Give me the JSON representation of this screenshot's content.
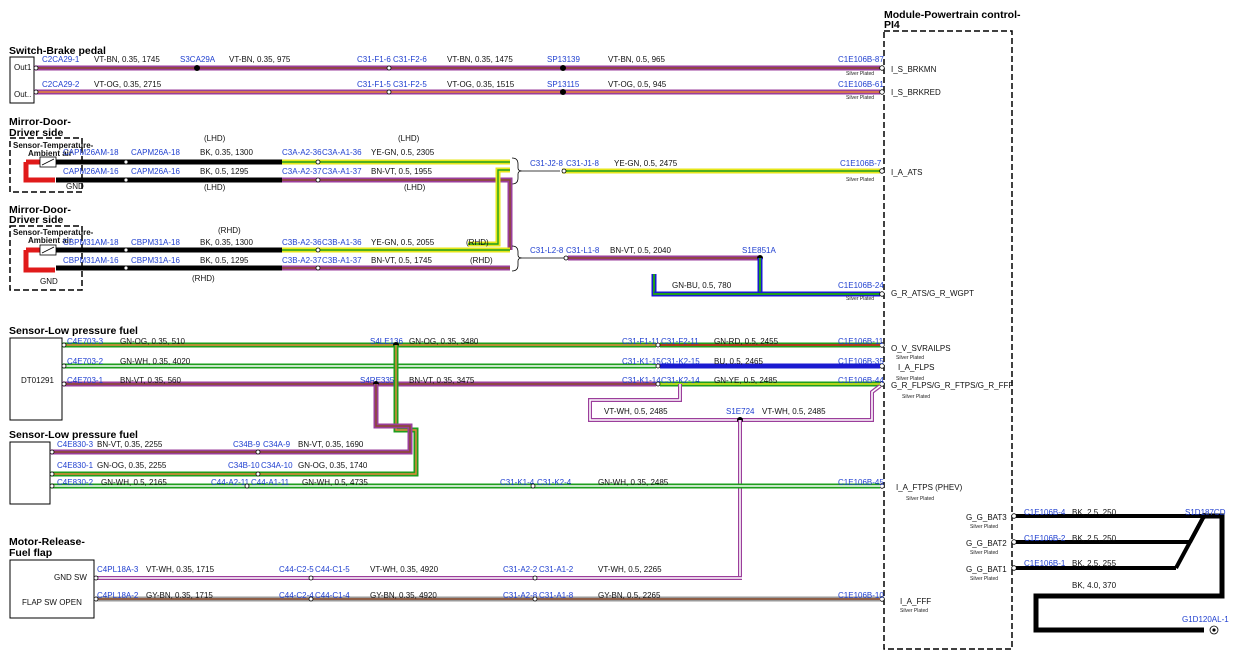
{
  "module": {
    "title_line1": "Module-Powertrain control-",
    "title_line2": "PI4",
    "pins": {
      "brkmn": "I_S_BRKMN",
      "brkred": "I_S_BRKRED",
      "ats": "I_A_ATS",
      "ats_wgpt": "G_R_ATS/G_R_WGPT",
      "svrailps": "O_V_SVRAILPS",
      "flps": "I_A_FLPS",
      "flps_ftps": "G_R_FLPS/G_R_FTPS/G_R_FFF",
      "ftps": "I_A_FTPS (PHEV)",
      "fff": "I_A_FFF",
      "bat3": "G_G_BAT3",
      "bat2": "G_G_BAT2",
      "bat1": "G_G_BAT1"
    },
    "silver": "Silver Plated"
  },
  "brake": {
    "title": "Switch-Brake pedal",
    "out1": "Out1",
    "out2": "Out..",
    "w1": {
      "c1": "C2CA29-1",
      "t1": "VT-BN, 0.35, 1745",
      "sp": "S3CA29A",
      "t2": "VT-BN, 0.35, 975",
      "c2": "C31-F1-6",
      "c3": "C31-F2-6",
      "t3": "VT-BN, 0.35, 1475",
      "sp2": "SP13139",
      "t4": "VT-BN, 0.5, 965",
      "c4": "C1E106B-87"
    },
    "w2": {
      "c1": "C2CA29-2",
      "t1": "VT-OG, 0.35, 2715",
      "c2": "C31-F1-5",
      "c3": "C31-F2-5",
      "t3": "VT-OG, 0.35, 1515",
      "sp2": "SP13115",
      "t4": "VT-OG, 0.5, 945",
      "c4": "C1E106B-61"
    }
  },
  "mirror1": {
    "title1": "Mirror-Door-",
    "title2": "Driver side",
    "sensor1": "Sensor-Temperature-",
    "sensor2": "Ambient air",
    "gnd": "GND",
    "lhd": "(LHD)",
    "w1": {
      "c1": "CAPM26AM-18",
      "c2": "CAPM26A-18",
      "t1": "BK, 0.35, 1300",
      "c3": "C3A-A2-36",
      "c4": "C3A-A1-36",
      "t2": "YE-GN, 0.5, 2305"
    },
    "w2": {
      "c1": "CAPM26AM-16",
      "c2": "CAPM26A-16",
      "t1": "BK, 0.5, 1295",
      "c3": "C3A-A2-37",
      "c4": "C3A-A1-37",
      "t2": "BN-VT, 0.5, 1955"
    },
    "out": {
      "c1": "C31-J2-8",
      "c2": "C31-J1-8",
      "t": "YE-GN, 0.5, 2475",
      "c3": "C1E106B-7"
    }
  },
  "mirror2": {
    "title1": "Mirror-Door-",
    "title2": "Driver side",
    "sensor1": "Sensor-Temperature-",
    "sensor2": "Ambient air",
    "gnd": "GND",
    "rhd": "(RHD)",
    "w1": {
      "c1": "CBPM31AM-18",
      "c2": "CBPM31A-18",
      "t1": "BK, 0.35, 1300",
      "c3": "C3B-A2-36",
      "c4": "C3B-A1-36",
      "t2": "YE-GN, 0.5, 2055"
    },
    "w2": {
      "c1": "CBPM31AM-16",
      "c2": "CBPM31A-16",
      "t1": "BK, 0.5, 1295",
      "c3": "C3B-A2-37",
      "c4": "C3B-A1-37",
      "t2": "BN-VT, 0.5, 1745"
    },
    "out": {
      "c1": "C31-L2-8",
      "c2": "C31-L1-8",
      "t": "BN-VT, 0.5, 2040",
      "sp": "S1E851A"
    },
    "gnbu": {
      "t": "GN-BU, 0.5, 780",
      "c": "C1E106B-24"
    }
  },
  "fuel1": {
    "title": "Sensor-Low pressure fuel",
    "box": "DT01291",
    "w1": {
      "c1": "C4E703-3",
      "t1": "GN-OG, 0.35, 510",
      "sp": "S4LE136",
      "t2": "GN-OG, 0.35, 3480",
      "c2": "C31-F1-11",
      "c3": "C31-F2-11",
      "t3": "GN-RD, 0.5, 2455",
      "c4": "C1E106B-11"
    },
    "w2": {
      "c1": "C4E703-2",
      "t1": "GN-WH, 0.35, 4020",
      "c2": "C31-K1-15",
      "c3": "C31-K2-15",
      "t3": "BU, 0.5, 2465",
      "c4": "C1E106B-35"
    },
    "w3": {
      "c1": "C4E703-1",
      "t1": "BN-VT, 0.35, 560",
      "sp": "S4RE335",
      "t2": "BN-VT, 0.35, 3475",
      "c2": "C31-K1-14",
      "c3": "C31-K2-14",
      "t3": "GN-YE, 0.5, 2485",
      "c4": "C1E106B-44"
    },
    "vtwh": {
      "t1": "VT-WH, 0.5, 2485",
      "sp": "S1E724",
      "t2": "VT-WH, 0.5, 2485"
    }
  },
  "fuel2": {
    "title": "Sensor-Low pressure fuel",
    "w1": {
      "c1": "C4E830-3",
      "t1": "BN-VT, 0.35, 2255",
      "c2": "C34B-9",
      "c3": "C34A-9",
      "t2": "BN-VT, 0.35, 1690"
    },
    "w2": {
      "c1": "C4E830-1",
      "t1": "GN-OG, 0.35, 2255",
      "c2": "C34B-10",
      "c3": "C34A-10",
      "t2": "GN-OG, 0.35, 1740"
    },
    "w3": {
      "c1": "C4E830-2",
      "t1": "GN-WH, 0.5, 2165",
      "c2": "C44-A2-11",
      "c3": "C44-A1-11",
      "t2": "GN-WH, 0.5, 4735",
      "c4": "C31-K1-4",
      "c5": "C31-K2-4",
      "t3": "GN-WH, 0.35, 2485",
      "c6": "C1E106B-45"
    }
  },
  "motor": {
    "title1": "Motor-Release-",
    "title2": "Fuel flap",
    "gndsw": "GND SW",
    "flapsw": "FLAP SW OPEN",
    "w1": {
      "c1": "C4PL18A-3",
      "t1": "VT-WH, 0.35, 1715",
      "c2": "C44-C2-5",
      "c3": "C44-C1-5",
      "t2": "VT-WH, 0.35, 4920",
      "c4": "C31-A2-2",
      "c5": "C31-A1-2",
      "t3": "VT-WH, 0.5, 2265"
    },
    "w2": {
      "c1": "C4PL18A-2",
      "t1": "GY-BN, 0.35, 1715",
      "c2": "C44-C2-4",
      "c3": "C44-C1-4",
      "t2": "GY-BN, 0.35, 4920",
      "c4": "C31-A2-8",
      "c5": "C31-A1-8",
      "t3": "GY-BN, 0.5, 2265",
      "c6": "C1E106B-10"
    }
  },
  "ground": {
    "b4": {
      "c": "C1E106B-4",
      "t": "BK, 2.5, 250"
    },
    "b2": {
      "c": "C1E106B-2",
      "t": "BK, 2.5, 250"
    },
    "b1": {
      "c": "C1E106B-1",
      "t": "BK, 2.5, 255"
    },
    "sp": "S1D187CD",
    "main": "BK, 4.0, 370",
    "g": "G1D120AL-1"
  },
  "colors": {
    "vt": "#9b3e9b",
    "og": "#e8873a",
    "bn": "#8a4b2a",
    "ye": "#e6e61a",
    "gn": "#1e9e1e",
    "bu": "#1a1ad0",
    "wh": "#ffffff",
    "rd": "#e01a1a",
    "gy": "#9a9a9a",
    "bk": "#000000"
  }
}
